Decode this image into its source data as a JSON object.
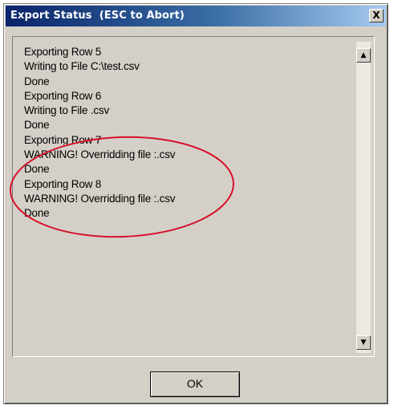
{
  "window": {
    "title": "Export Status  (ESC to Abort)",
    "close_label": "X"
  },
  "log": {
    "lines": [
      "Exporting Row 5",
      "Writing to File C:\\test.csv",
      "Done",
      "Exporting Row 6",
      "Writing to File .csv",
      "Done",
      "Exporting Row 7",
      "WARNING! Overridding file :.csv",
      "Done",
      "Exporting Row 8",
      "WARNING! Overridding file :.csv",
      "Done"
    ]
  },
  "scrollbar": {
    "up_icon": "▲",
    "down_icon": "▼"
  },
  "buttons": {
    "ok_label": "OK"
  },
  "annotation": {
    "color": "#d8102a"
  },
  "colors": {
    "title_start": "#0a246a",
    "title_end": "#a6caf0",
    "dialog_bg": "#d4d0c8"
  }
}
